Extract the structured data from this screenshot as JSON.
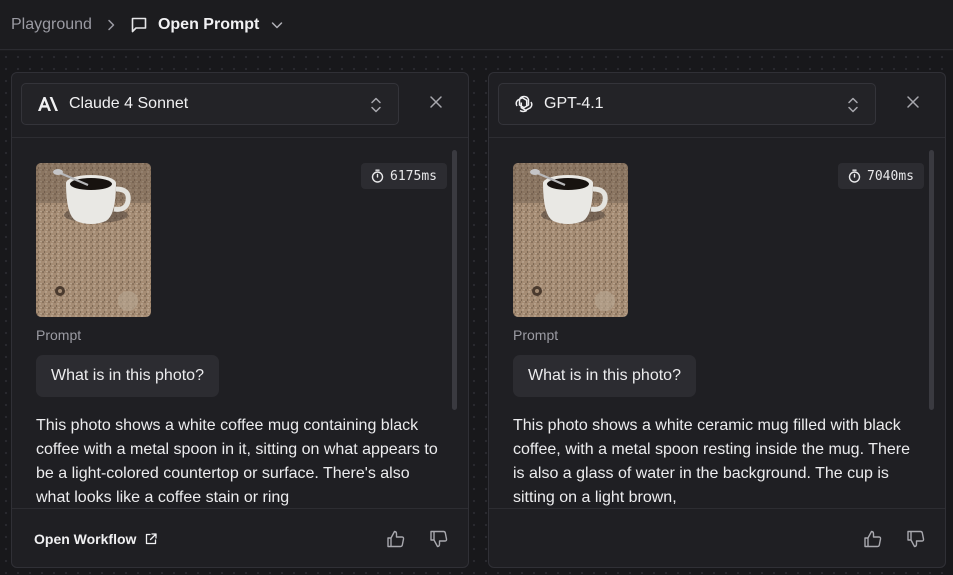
{
  "breadcrumb": {
    "root": "Playground",
    "current": "Open Prompt"
  },
  "panels": [
    {
      "model": "Claude 4 Sonnet",
      "model_logo": "anthropic-logo",
      "latency": "6175ms",
      "prompt_label": "Prompt",
      "prompt": "What is in this photo?",
      "response": "This photo shows a white coffee mug containing black coffee with a metal spoon in it, sitting on what appears to be a light-colored countertop or surface. There's also what looks like a coffee stain or ring",
      "footer_link": "Open Workflow"
    },
    {
      "model": "GPT-4.1",
      "model_logo": "openai-logo",
      "latency": "7040ms",
      "prompt_label": "Prompt",
      "prompt": "What is in this photo?",
      "response": "This photo shows a white ceramic mug filled with black coffee, with a metal spoon resting inside the mug. There is also a glass of water in the background. The cup is sitting on a light brown,"
    }
  ],
  "colors": {
    "background": "#18181b",
    "panel": "#1f1f23",
    "text": "#ececee",
    "muted": "#9b9ba3"
  }
}
